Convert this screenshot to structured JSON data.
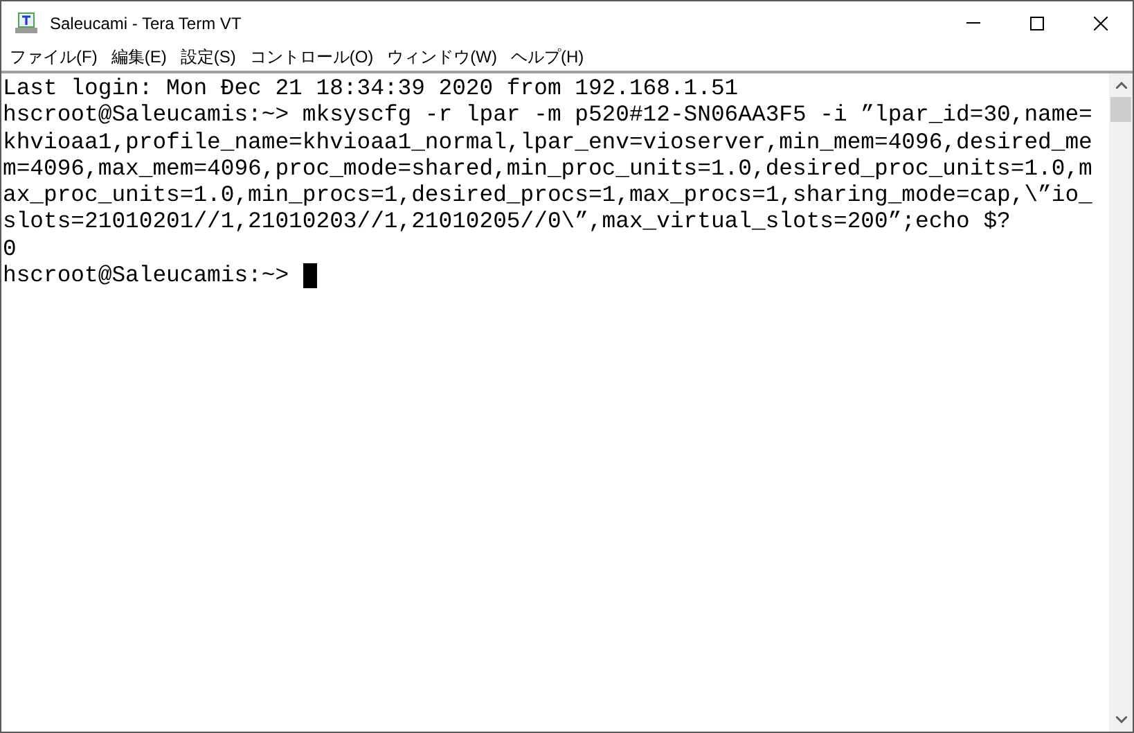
{
  "window": {
    "title": "Saleucami - Tera Term VT"
  },
  "menu": [
    "ファイル(F)",
    "編集(E)",
    "設定(S)",
    "コントロール(O)",
    "ウィンドウ(W)",
    "ヘルプ(H)"
  ],
  "terminal": {
    "lines": [
      "Last login: Mon Đec 21 18:34:39 2020 from 192.168.1.51",
      "hscroot@Saleucamis:~> mksyscfg -r lpar -m p520#12-SN06AA3F5 -i ”lpar_id=30,name=",
      "khvioaa1,profile_name=khvioaa1_normal,lpar_env=vioserver,min_mem=4096,desired_me",
      "m=4096,max_mem=4096,proc_mode=shared,min_proc_units=1.0,desired_proc_units=1.0,m",
      "ax_proc_units=1.0,min_procs=1,desired_procs=1,max_procs=1,sharing_mode=cap,\\”io_",
      "slots=21010201//1,21010203//1,21010205//0\\”,max_virtual_slots=200”;echo $?",
      "0"
    ],
    "prompt": "hscroot@Saleucamis:~>",
    "cursor": true
  }
}
